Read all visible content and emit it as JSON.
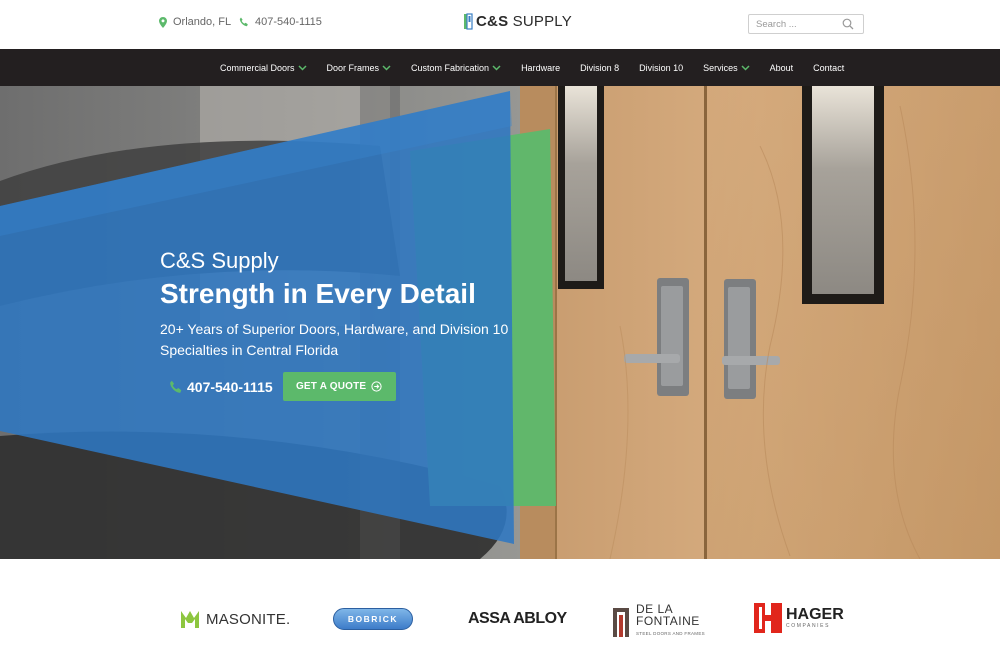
{
  "topbar": {
    "location": "Orlando, FL",
    "phone": "407-540-1115",
    "logo_brand": "C&S",
    "logo_word": "SUPPLY",
    "search_placeholder": "Search ..."
  },
  "nav": {
    "items": [
      {
        "label": "Commercial Doors",
        "dropdown": true
      },
      {
        "label": "Door Frames",
        "dropdown": true
      },
      {
        "label": "Custom Fabrication",
        "dropdown": true
      },
      {
        "label": "Hardware",
        "dropdown": false
      },
      {
        "label": "Division 8",
        "dropdown": false
      },
      {
        "label": "Division 10",
        "dropdown": false
      },
      {
        "label": "Services",
        "dropdown": true
      },
      {
        "label": "About",
        "dropdown": false
      },
      {
        "label": "Contact",
        "dropdown": false
      }
    ]
  },
  "hero": {
    "eyebrow": "C&S Supply",
    "headline": "Strength in Every Detail",
    "subline": "20+ Years of Superior Doors, Hardware, and Division 10 Specialties in Central Florida",
    "cta_phone": "407-540-1115",
    "cta_button": "GET A QUOTE"
  },
  "brands": {
    "masonite": "MASONITE.",
    "bobrick": "BOBRICK",
    "assa_abloy": "ASSA ABLOY",
    "delafontaine_line1": "DE LA",
    "delafontaine_line2": "FONTAINE",
    "delafontaine_tag": "STEEL DOORS AND FRAMES",
    "hager": "HAGER",
    "hager_tag": "COMPANIES"
  },
  "colors": {
    "nav_bg": "#231f20",
    "accent_green": "#5cb96b",
    "accent_blue": "#3a7fc4"
  }
}
